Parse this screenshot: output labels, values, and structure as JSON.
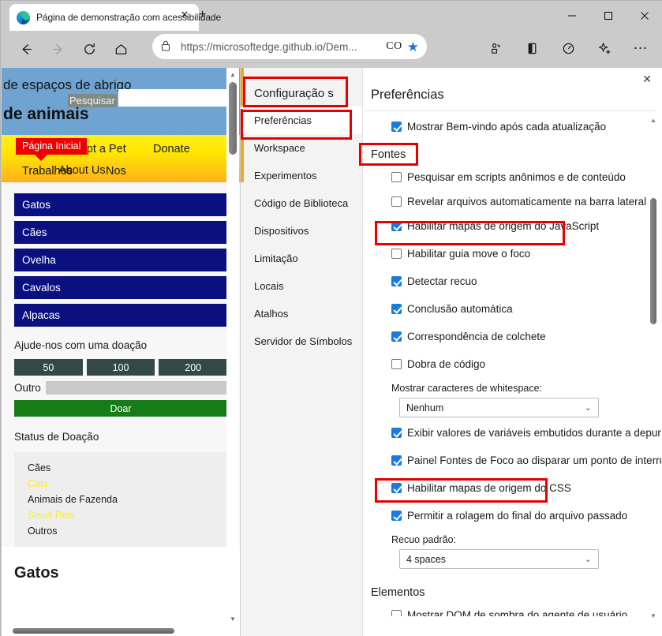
{
  "browser": {
    "tab_title": "Página de demonstração com acessibilidade",
    "tab_close_label": "✕",
    "new_tab_label": "+",
    "url": "https://microsoftedge.github.io/Dem...",
    "profile_label": "CO",
    "window": {
      "minimize": "—",
      "maximize": "▢",
      "close": "✕"
    },
    "toolbar_icons": [
      "back-arrow",
      "forward-arrow",
      "refresh",
      "home",
      "lock",
      "star",
      "collections",
      "split-screen",
      "performance",
      "copilot",
      "more"
    ],
    "more_label": "…"
  },
  "webpage": {
    "banner": {
      "line1": "de espaços de abrigo",
      "line2": "de animais",
      "search_label": "Pesquisar",
      "search_value": ""
    },
    "nav": {
      "tooltip": "Página Inicial",
      "adopt": "Adopt a Pet",
      "donate": "Donate",
      "about": "About Us",
      "trabalhos": "Trabalhos",
      "nos": "Nos"
    },
    "categories": [
      "Gatos",
      "Cães",
      "Ovelha",
      "Cavalos",
      "Alpacas"
    ],
    "donation": {
      "title": "Ajude-nos com uma doação",
      "amounts": [
        "50",
        "100",
        "200"
      ],
      "other_label": "Outro",
      "other_value": "",
      "donate_button": "Doar"
    },
    "status": {
      "title": "Status de Doação",
      "rows": [
        {
          "label": "Cães",
          "highlight": false
        },
        {
          "label": "Cats",
          "highlight": true
        },
        {
          "label": "Animais de Fazenda",
          "highlight": false
        },
        {
          "label": "Small Pets",
          "highlight": true
        },
        {
          "label": "Outros",
          "highlight": false
        }
      ]
    },
    "bottom_heading": "Gatos"
  },
  "devtools": {
    "sidebar_title": "Configuração s",
    "nav_items": [
      "Preferências",
      "Workspace",
      "Experimentos",
      "Código de Biblioteca",
      "Dispositivos",
      "Limitação",
      "Locais",
      "Atalhos",
      "Servidor de Símbolos"
    ],
    "selected_nav": "Preferências",
    "panel_title": "Preferências",
    "close_label": "✕",
    "top_preference": {
      "label": "Mostrar Bem-vindo após cada atualização",
      "checked": true
    },
    "groups": [
      {
        "name": "Fontes",
        "items": [
          {
            "label": "Pesquisar em scripts anônimos e de conteúdo",
            "checked": false
          },
          {
            "label": "Revelar arquivos automaticamente na barra lateral",
            "checked": false
          },
          {
            "label": "Habilitar mapas de origem do JavaScript",
            "checked": true
          },
          {
            "label": "Habilitar guia move o foco",
            "checked": false
          },
          {
            "label": "Detectar recuo",
            "checked": true
          },
          {
            "label": "Conclusão automática",
            "checked": true
          },
          {
            "label": "Correspondência de colchete",
            "checked": true
          },
          {
            "label": "Dobra de código",
            "checked": false
          }
        ],
        "select1": {
          "label": "Mostrar caracteres de whitespace:",
          "value": "Nenhum"
        },
        "items2": [
          {
            "label": "Exibir valores de variáveis embutidos durante a depuração",
            "checked": true
          },
          {
            "label": "Painel Fontes de Foco ao disparar um ponto de interrupção",
            "checked": true
          },
          {
            "label": "Habilitar mapas de origem do CSS",
            "checked": true
          },
          {
            "label": "Permitir a rolagem do final do arquivo passado",
            "checked": true
          }
        ],
        "select2": {
          "label": "Recuo padrão:",
          "value": "4 spaces"
        }
      },
      {
        "name": "Elementos",
        "items": [
          {
            "label": "Mostrar DOM de sombra do agente de usuário",
            "checked": false
          }
        ]
      }
    ]
  },
  "annotations": {
    "accent_red": "#e60000",
    "accent_blue": "#1a7ae0"
  }
}
